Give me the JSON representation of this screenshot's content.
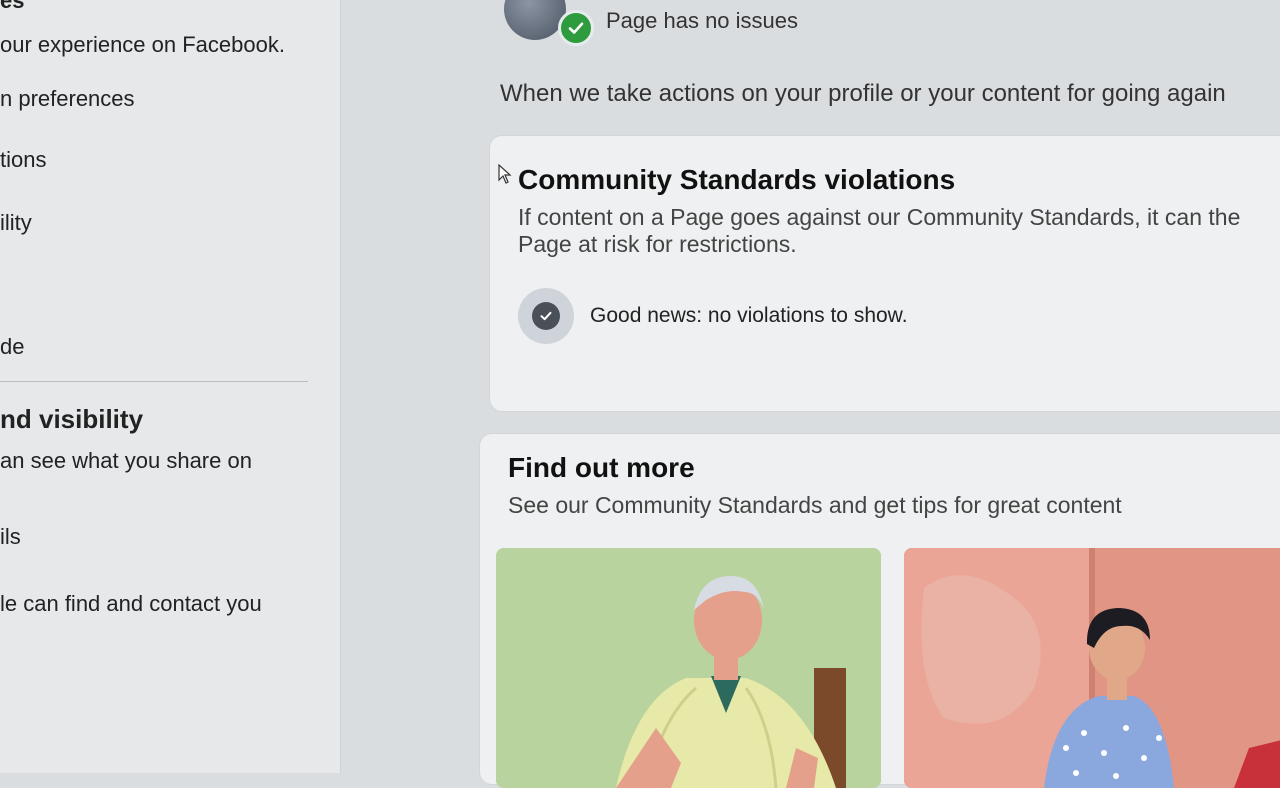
{
  "sidebar": {
    "title_partial": "es",
    "subtitle_partial": "our experience on Facebook.",
    "items": [
      {
        "label": "n preferences"
      },
      {
        "label": "tions"
      },
      {
        "label": "ility"
      },
      {
        "label": "de"
      }
    ],
    "section_title_partial": "nd visibility",
    "section_subtitle_partial": "an see what you share on",
    "items2": [
      {
        "label": "ils"
      },
      {
        "label": "le can find and contact you"
      }
    ]
  },
  "status": {
    "text": "Page has no issues",
    "icon": "check-circle-icon",
    "accent": "#2e9c3e"
  },
  "intro": {
    "text": "When we take actions on your profile or your content for going again"
  },
  "violations_card": {
    "title": "Community Standards violations",
    "description": "If content on a Page goes against our Community Standards, it can the Page at risk for restrictions.",
    "empty_state": "Good news: no violations to show."
  },
  "find_out_more": {
    "title": "Find out more",
    "description": "See our Community Standards and get tips for great content"
  }
}
